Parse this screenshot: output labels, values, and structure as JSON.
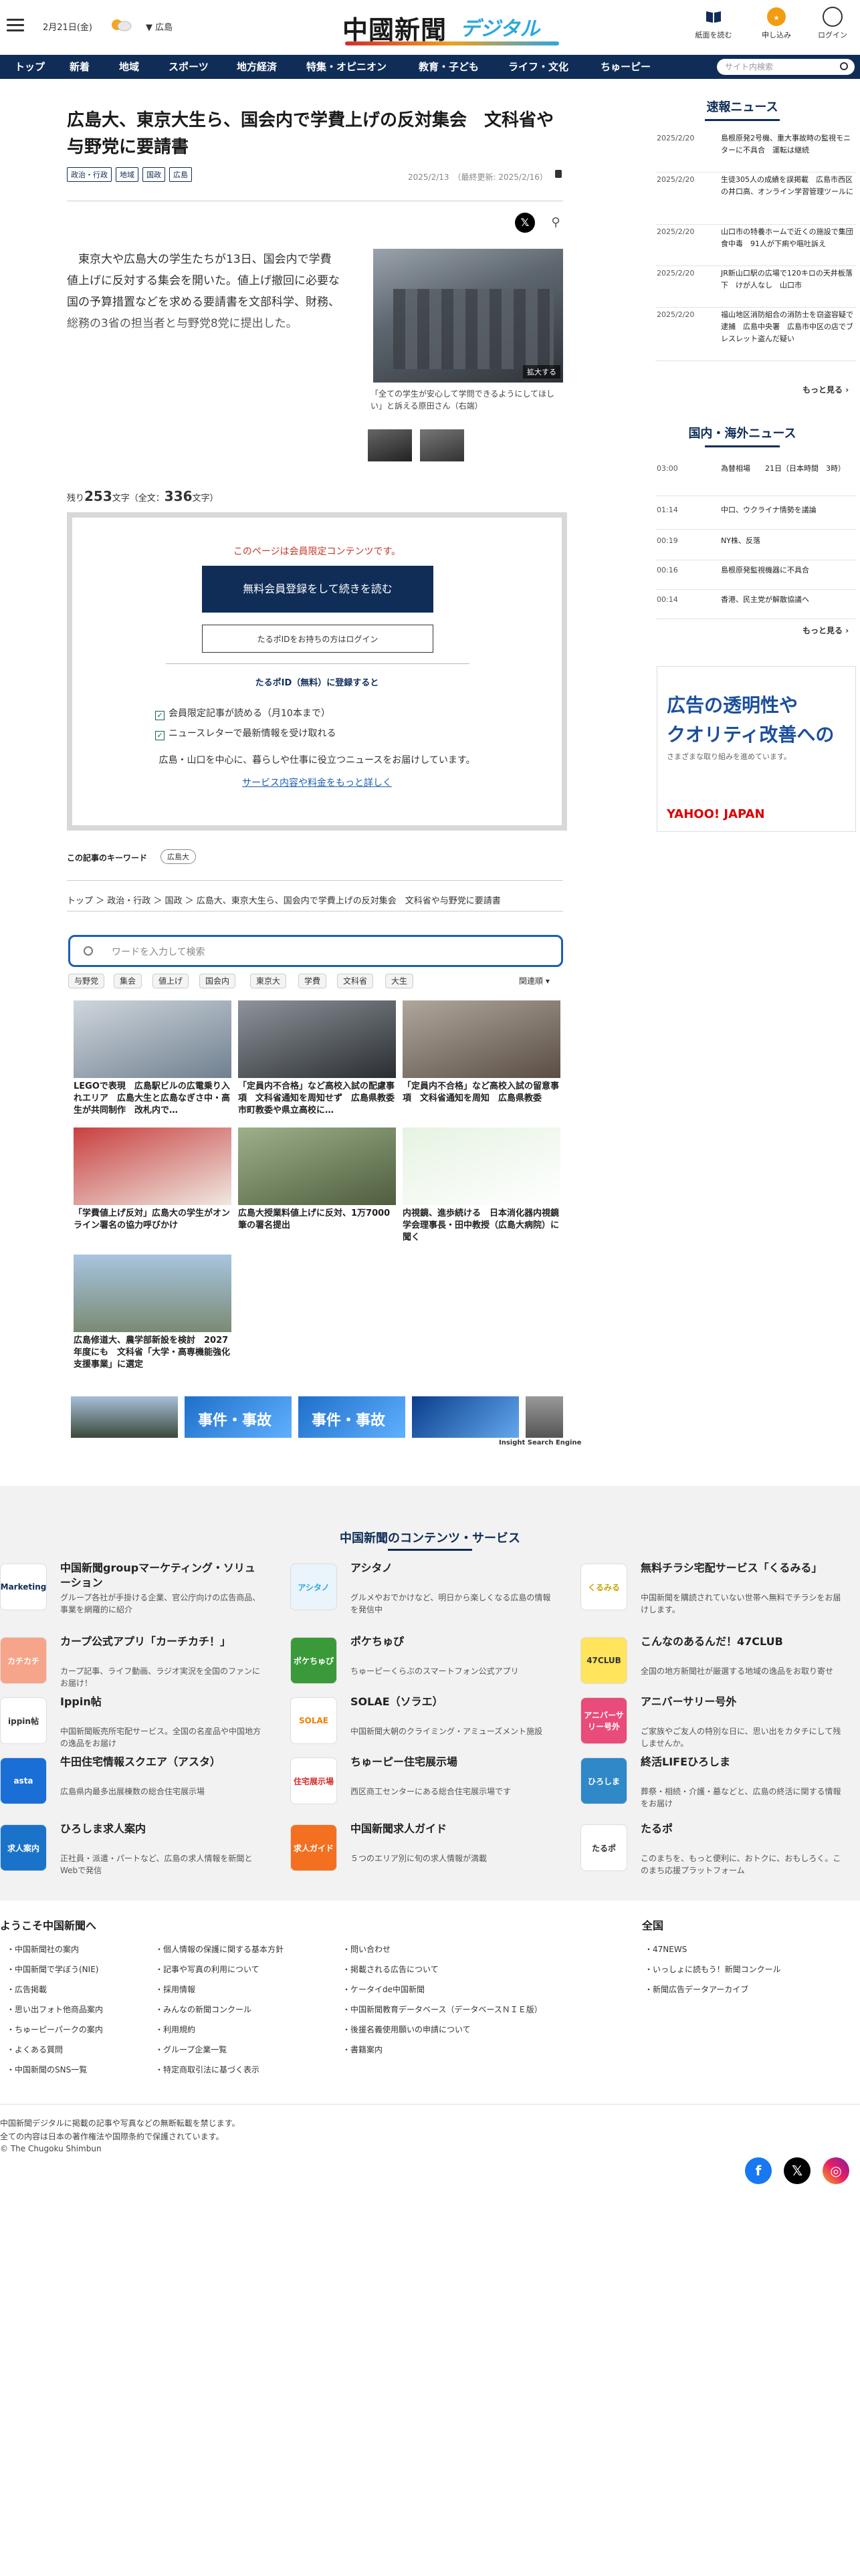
{
  "header": {
    "date": "2月21日(金)",
    "region": "広島",
    "logo_main": "中國新聞",
    "logo_sub": "デジタル",
    "buttons": [
      "紙面を読む",
      "申し込み",
      "ログイン"
    ]
  },
  "nav": {
    "items": [
      "トップ",
      "新着",
      "地域",
      "スポーツ",
      "地方経済",
      "特集・オピニオン",
      "教育・子ども",
      "ライフ・文化",
      "ちゅーピー"
    ],
    "search_placeholder": "サイト内検索"
  },
  "article": {
    "title": "広島大、東京大生ら、国会内で学費上げの反対集会　文科省や与野党に要請書",
    "tags": [
      "政治・行政",
      "地域",
      "国政",
      "広島"
    ],
    "date": "2025/2/13　（最終更新: 2025/2/16）",
    "body": "東京大や広島大の学生たちが13日、国会内で学費値上げに反対する集会を開いた。値上げ撤回に必要な国の予算措置などを求める要請書を文部科学、財務、総務の3省の担当者と与野党8党に提出した。",
    "photo_enlarge": "拡大する",
    "photo_caption": "「全ての学生が安心して学問できるようにしてほしい」と訴える原田さん（右端）",
    "remaining_prefix": "残り",
    "remaining_count": "253",
    "remaining_mid": "文字（全文：",
    "total_count": "336",
    "remaining_suffix": "文字）"
  },
  "paywall": {
    "message": "このページは会員限定コンテンツです。",
    "register_button": "無料会員登録をして続きを読む",
    "login_button": "たるポIDをお持ちの方はログイン",
    "sub_heading": "たるポID（無料）に登録すると",
    "benefits": [
      "会員限定記事が読める（月10本まで）",
      "ニュースレターで最新情報を受け取れる"
    ],
    "description": "広島・山口を中心に、暮らしや仕事に役立つニュースをお届けしています。",
    "link": "サービス内容や料金をもっと詳しく"
  },
  "keywords": {
    "label": "この記事のキーワード",
    "tag": "広島大"
  },
  "breadcrumb": "トップ ＞ 政治・行政 ＞ 国政 ＞ 広島大、東京大生ら、国会内で学費上げの反対集会　文科省や与野党に要請書",
  "related": {
    "search_placeholder": "ワードを入力して検索",
    "chips": [
      "与野党",
      "集会",
      "値上げ",
      "国会内",
      "東京大",
      "学費",
      "文科省",
      "大生"
    ],
    "sort": "関連順",
    "items": [
      "LEGOで表現　広島駅ビルの広電乗り入れエリア　広島大生と広島なぎさ中・高生が共同制作　改札内で…",
      "「定員内不合格」など高校入試の配慮事項　文科省通知を周知せず　広島県教委　市町教委や県立高校に…",
      "「定員内不合格」など高校入試の留意事項　文科省通知を周知　広島県教委",
      "「学費値上げ反対」広島大の学生がオンライン署名の協力呼びかけ",
      "広島大授業料値上げに反対、1万7000筆の署名提出",
      "内視鏡、進歩続ける　日本消化器内視鏡学会理事長・田中教授（広島大病院）に聞く",
      "広島修道大、農学部新設を検討　2027年度にも　文科省「大学・高専機能強化支援事業」に選定"
    ],
    "banners": [
      "",
      "事件・事故",
      "事件・事故",
      "",
      ""
    ],
    "engine": "Insight Search Engine"
  },
  "sidebar": {
    "breaking_title": "速報ニュース",
    "breaking": [
      {
        "date": "2025/2/20",
        "text": "島根原発2号機、重大事故時の監視モニターに不具合　運転は継続"
      },
      {
        "date": "2025/2/20",
        "text": "生徒305人の成績を誤掲載　広島市西区の井口高、オンライン学習管理ツールに"
      },
      {
        "date": "2025/2/20",
        "text": "山口市の特養ホームで近くの施設で集団食中毒　91人が下痢や嘔吐訴え"
      },
      {
        "date": "2025/2/20",
        "text": "JR新山口駅の広場で120キロの天井板落下　けが人なし　山口市"
      },
      {
        "date": "2025/2/20",
        "text": "福山地区消防組合の消防士を窃盗容疑で逮捕　広島中央署　広島市中区の店でブレスレット盗んだ疑い"
      }
    ],
    "more": "もっと見る",
    "world_title": "国内・海外ニュース",
    "world": [
      {
        "date": "03:00",
        "text": "為替相場　　21日（日本時間　3時）"
      },
      {
        "date": "01:14",
        "text": "中口、ウクライナ情勢を議論"
      },
      {
        "date": "00:19",
        "text": "NY株、反落"
      },
      {
        "date": "00:16",
        "text": "島根原発監視機器に不具合"
      },
      {
        "date": "00:14",
        "text": "香港、民主党が解散協議へ"
      }
    ],
    "ad": {
      "line1": "広告の透明性や",
      "line2": "クオリティ改善への",
      "line3": "さまざまな取り組みを進めています。",
      "logo": "YAHOO! JAPAN"
    }
  },
  "services": {
    "title": "中国新聞のコンテンツ・サービス",
    "items": [
      {
        "icon_text": "Marketing",
        "name": "中国新聞groupマーケティング・ソリューション",
        "desc": "グループ各社が手掛ける企業、官公庁向けの広告商品、事業を網羅的に紹介"
      },
      {
        "icon_text": "アシタノ",
        "name": "アシタノ",
        "desc": "グルメやおでかけなど、明日から楽しくなる広島の情報を発信中"
      },
      {
        "icon_text": "くるみる",
        "name": "無料チラシ宅配サービス「くるみる」",
        "desc": "中国新聞を購読されていない世帯へ無料でチラシをお届けします。"
      },
      {
        "icon_text": "カチカチ",
        "name": "カープ公式アプリ「カーチカチ！」",
        "desc": "カープ記事、ライフ動画、ラジオ実況を全国のファンにお届け！"
      },
      {
        "icon_text": "ポケちゅぴ",
        "name": "ポケちゅぴ",
        "desc": "ちゅーピーくらぶのスマートフォン公式アプリ"
      },
      {
        "icon_text": "47CLUB",
        "name": "こんなのあるんだ！47CLUB",
        "desc": "全国の地方新聞社が厳選する地域の逸品をお取り寄せ"
      },
      {
        "icon_text": "ippin帖",
        "name": "Ippin帖",
        "desc": "中国新聞販売所宅配サービス。全国の名産品や中国地方の逸品をお届け"
      },
      {
        "icon_text": "SOLAE",
        "name": "SOLAE（ソラエ）",
        "desc": "中国新聞大朝のクライミング・アミューズメント施設"
      },
      {
        "icon_text": "アニバーサリー号外",
        "name": "アニバーサリー号外",
        "desc": "ご家族やご友人の特別な日に、思い出をカタチにして残しませんか。"
      },
      {
        "icon_text": "asta",
        "name": "牛田住宅情報スクエア（アスタ）",
        "desc": "広島県内最多出展棟数の総合住宅展示場"
      },
      {
        "icon_text": "住宅展示場",
        "name": "ちゅーピー住宅展示場",
        "desc": "西区商工センターにある総合住宅展示場です"
      },
      {
        "icon_text": "ひろしま",
        "name": "終活LIFEひろしま",
        "desc": "葬祭・相続・介護・墓などと、広島の終活に関する情報をお届け"
      },
      {
        "icon_text": "求人案内",
        "name": "ひろしま求人案内",
        "desc": "正社員・派遣・パートなど、広島の求人情報を新聞とWebで発信"
      },
      {
        "icon_text": "求人ガイド",
        "name": "中国新聞求人ガイド",
        "desc": "５つのエリア別に旬の求人情報が満載"
      },
      {
        "icon_text": "たるポ",
        "name": "たるポ",
        "desc": "このまちを、もっと便利に、おトクに、おもしろく。このまち応援プラットフォーム"
      }
    ]
  },
  "footer": {
    "heading1": "ようこそ中国新聞へ",
    "heading2": "全国",
    "col1": [
      "中国新聞社の案内",
      "中国新聞で学ぼう(NIE)",
      "広告掲載",
      "思い出フォト他商品案内",
      "ちゅーピーパークの案内",
      "よくある質問",
      "中国新聞のSNS一覧"
    ],
    "col2": [
      "個人情報の保護に関する基本方針",
      "記事や写真の利用について",
      "採用情報",
      "みんなの新聞コンクール",
      "利用規約",
      "グループ企業一覧",
      "特定商取引法に基づく表示"
    ],
    "col3": [
      "問い合わせ",
      "掲載される広告について",
      "ケータイde中国新聞",
      "中国新聞教育データベース（データベースＮＩＥ版）",
      "後援名義使用願いの申請について",
      "書籍案内"
    ],
    "col4": [
      "47NEWS",
      "いっしょに読もう！新聞コンクール",
      "新聞広告データアーカイブ"
    ],
    "notes": [
      "中国新聞デジタルに掲載の記事や写真などの無断転載を禁じます。",
      "全ての内容は日本の著作権法や国際条約で保護されています。",
      "© The Chugoku Shimbun"
    ]
  },
  "colors": {
    "navy": "#0f2d57",
    "accent_red": "#c0392b",
    "link_blue": "#1b5fb3"
  }
}
